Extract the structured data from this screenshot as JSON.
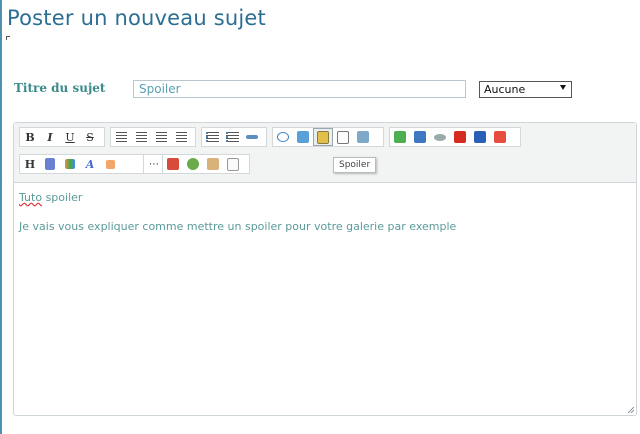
{
  "page": {
    "title": "Poster un nouveau sujet"
  },
  "subject": {
    "label": "Titre du sujet",
    "value": "Spoiler"
  },
  "prefix": {
    "selected": "Aucune"
  },
  "toolbar": {
    "row1": [
      {
        "name": "bold-button",
        "glyph": "B",
        "kind": "b"
      },
      {
        "name": "italic-button",
        "glyph": "I",
        "kind": "i"
      },
      {
        "name": "underline-button",
        "glyph": "U",
        "kind": "u"
      },
      {
        "name": "strike-button",
        "glyph": "S",
        "kind": "s"
      }
    ],
    "tooltip": "Spoiler",
    "row2_letters": {
      "heading": "H",
      "font": "A"
    }
  },
  "content": {
    "line1_word": "Tuto",
    "line1_rest": " spoiler",
    "line2": "Je vais vous expliquer comme mettre un spoiler pour votre galerie par exemple"
  },
  "colors": {
    "title": "#2b6e93",
    "label": "#3a8a8a",
    "text": "#5b9a9a"
  }
}
